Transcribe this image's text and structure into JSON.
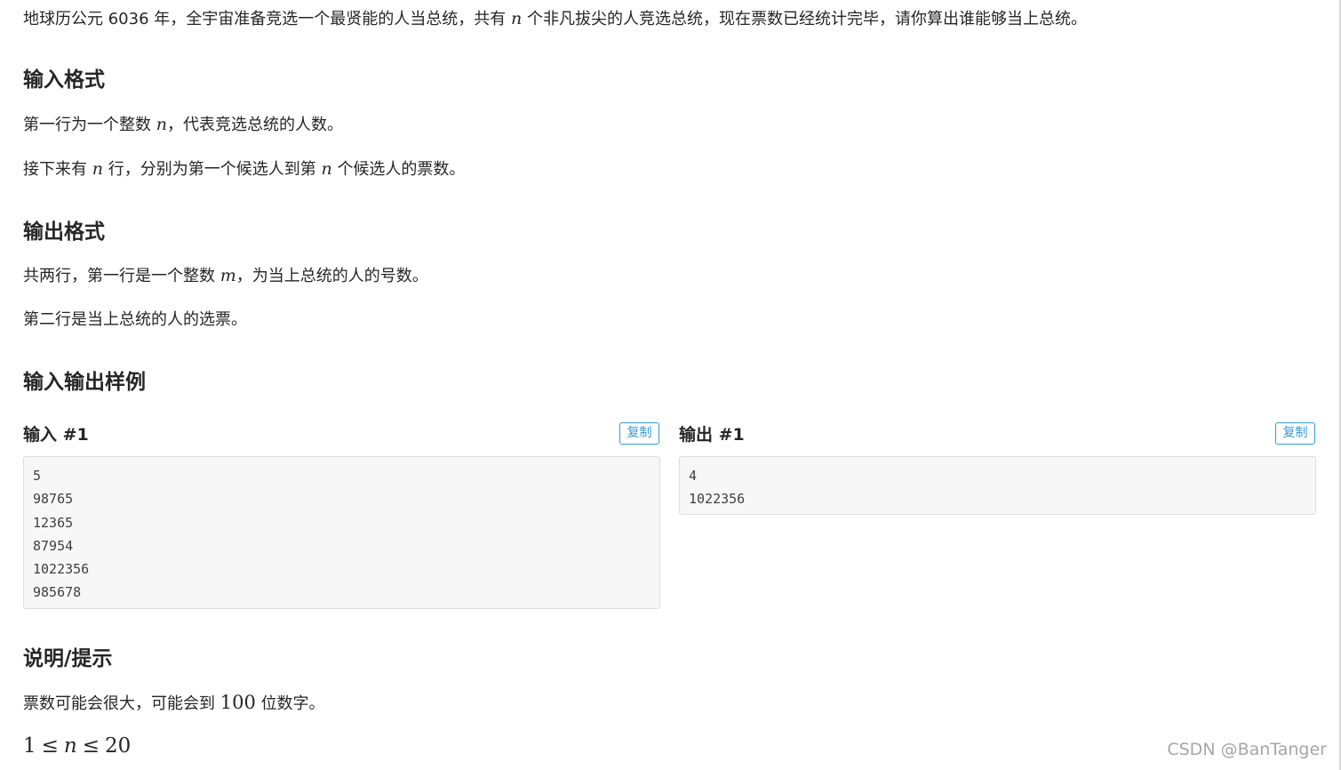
{
  "description": {
    "intro_before_n": "地球历公元 6036 年，全宇宙准备竞选一个最贤能的人当总统，共有",
    "var_n": "n",
    "intro_after_n": "个非凡拔尖的人竞选总统，现在票数已经统计完毕，请你算出谁能够当上总统。"
  },
  "input_format": {
    "heading": "输入格式",
    "line1_before": "第一行为一个整数",
    "line1_var": "n",
    "line1_after": "，代表竞选总统的人数。",
    "line2_before": "接下来有",
    "line2_var1": "n",
    "line2_mid": "行，分别为第一个候选人到第",
    "line2_var2": "n",
    "line2_after": "个候选人的票数。"
  },
  "output_format": {
    "heading": "输出格式",
    "line1_before": "共两行，第一行是一个整数",
    "line1_var": "m",
    "line1_after": "，为当上总统的人的号数。",
    "line2": "第二行是当上总统的人的选票。"
  },
  "samples": {
    "heading": "输入输出样例",
    "input": {
      "label": "输入 #1",
      "copy_label": "复制",
      "lines": [
        "5",
        "98765",
        "12365",
        "87954",
        "1022356",
        "985678"
      ]
    },
    "output": {
      "label": "输出 #1",
      "copy_label": "复制",
      "lines": [
        "4",
        "1022356"
      ]
    }
  },
  "hint": {
    "heading": "说明/提示",
    "line1_before": "票数可能会很大，可能会到",
    "line1_num": "100",
    "line1_after": "位数字。",
    "formula_lhs": "1",
    "formula_op1": "≤",
    "formula_var": "n",
    "formula_op2": "≤",
    "formula_rhs": "20"
  },
  "watermark": "CSDN @BanTanger"
}
